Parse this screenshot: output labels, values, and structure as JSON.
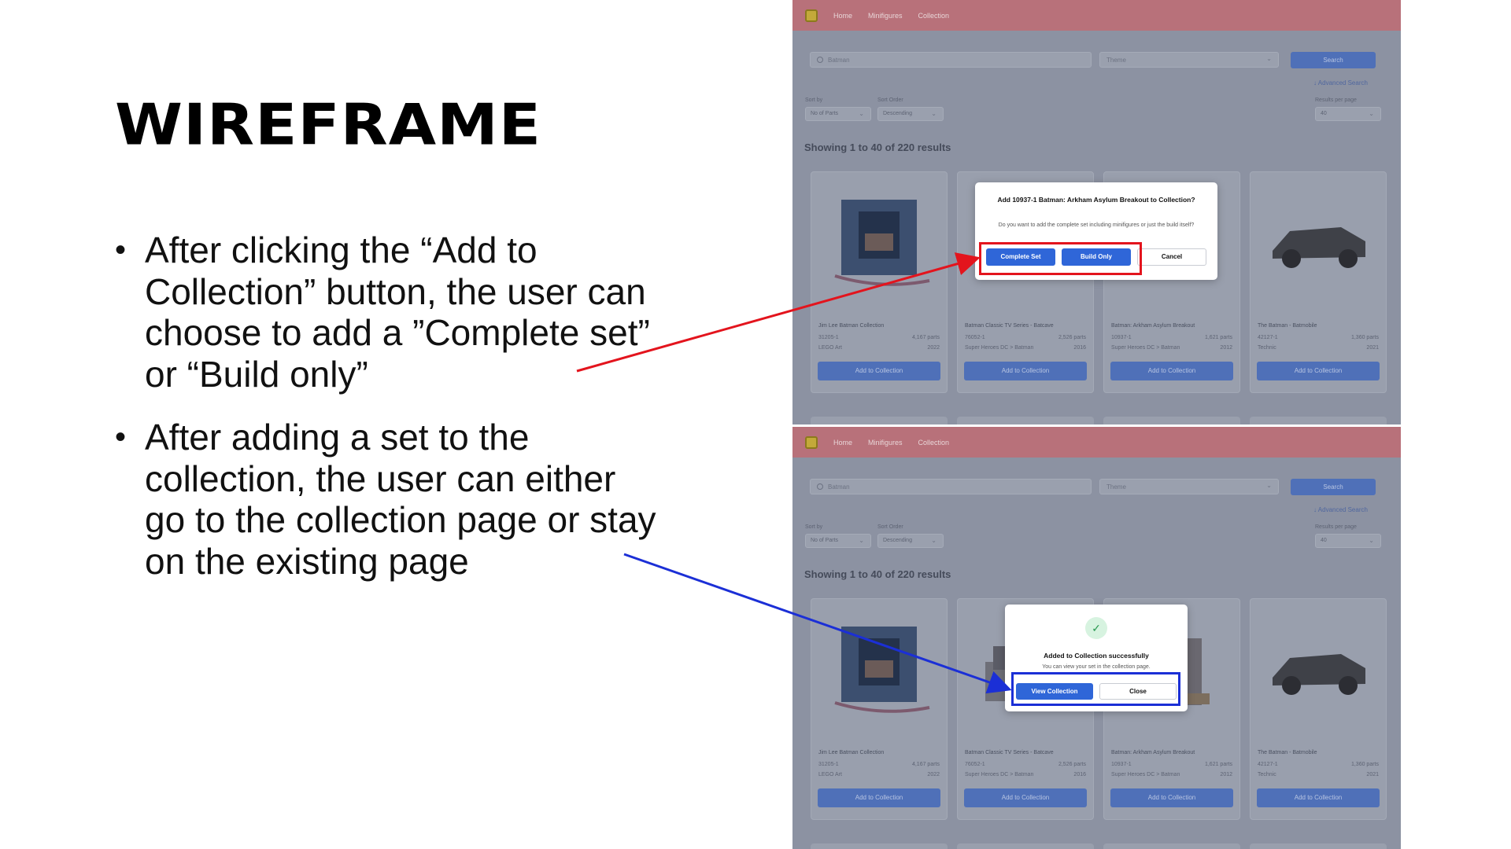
{
  "slide": {
    "title": "WIREFRAME",
    "bullets": [
      "After clicking the “Add to Collection” button, the user can choose to add a ”Complete set” or “Build only”",
      "After adding a set to the collection, the user can either go to the collection page or stay on the existing page"
    ],
    "bullet_glyph": "•"
  },
  "app": {
    "nav": {
      "home": "Home",
      "minifigures": "Minifigures",
      "collection": "Collection"
    },
    "search": {
      "value": "Batman",
      "theme_placeholder": "Theme",
      "button": "Search",
      "advanced": "↓ Advanced Search"
    },
    "controls": {
      "sort_by_label": "Sort by",
      "sort_by_value": "No of Parts",
      "sort_order_label": "Sort Order",
      "sort_order_value": "Descending",
      "per_page_label": "Results per page",
      "per_page_value": "40"
    },
    "results_heading": "Showing 1 to 40 of 220 results",
    "cards": [
      {
        "name": "Jim Lee Batman Collection",
        "number": "31205-1",
        "parts": "4,167 parts",
        "theme": "LEGO Art",
        "year": "2022",
        "button": "Add to Collection"
      },
      {
        "name": "Batman Classic TV Series - Batcave",
        "number": "76052-1",
        "parts": "2,526 parts",
        "theme": "Super Heroes DC > Batman",
        "year": "2016",
        "button": "Add to Collection"
      },
      {
        "name": "Batman: Arkham Asylum Breakout",
        "number": "10937-1",
        "parts": "1,621 parts",
        "theme": "Super Heroes DC > Batman",
        "year": "2012",
        "button": "Add to Collection"
      },
      {
        "name": "The Batman - Batmobile",
        "number": "42127-1",
        "parts": "1,360 parts",
        "theme": "Technic",
        "year": "2021",
        "button": "Add to Collection"
      }
    ]
  },
  "modal_add": {
    "title": "Add 10937-1 Batman: Arkham Asylum Breakout to Collection?",
    "description": "Do you want to add the complete set including minifigures or just the build itself?",
    "complete_set": "Complete Set",
    "build_only": "Build Only",
    "cancel": "Cancel"
  },
  "modal_success": {
    "check": "✓",
    "title": "Added to Collection successfully",
    "description": "You can view your set in the collection page.",
    "view_collection": "View Collection",
    "close": "Close"
  },
  "colors": {
    "red_highlight": "#e3141d",
    "blue_highlight": "#1b2fd6",
    "primary": "#2f66d8"
  }
}
